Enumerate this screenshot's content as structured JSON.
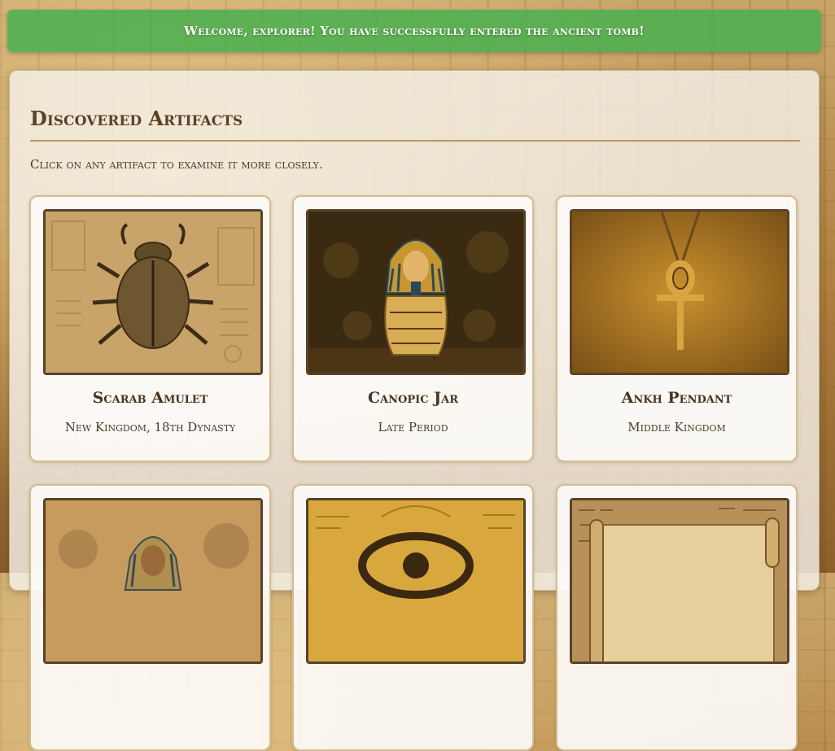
{
  "banner": {
    "message": "Welcome, explorer! You have successfully entered the ancient tomb!"
  },
  "section": {
    "title": "Discovered Artifacts",
    "subtitle": "Click on any artifact to examine it more closely."
  },
  "artifacts": [
    {
      "name": "Scarab Amulet",
      "era": "New Kingdom, 18th Dynasty",
      "icon": "scarab-image"
    },
    {
      "name": "Canopic Jar",
      "era": "Late Period",
      "icon": "canopic-jar-image"
    },
    {
      "name": "Ankh Pendant",
      "era": "Middle Kingdom",
      "icon": "ankh-image"
    },
    {
      "name": "",
      "era": "",
      "icon": "pharaoh-statue-image"
    },
    {
      "name": "",
      "era": "",
      "icon": "eye-of-horus-image"
    },
    {
      "name": "",
      "era": "",
      "icon": "papyrus-scroll-image"
    }
  ],
  "colors": {
    "banner": "#4caf50",
    "heading": "#5a4226",
    "card_border": "#d6bc8e"
  }
}
